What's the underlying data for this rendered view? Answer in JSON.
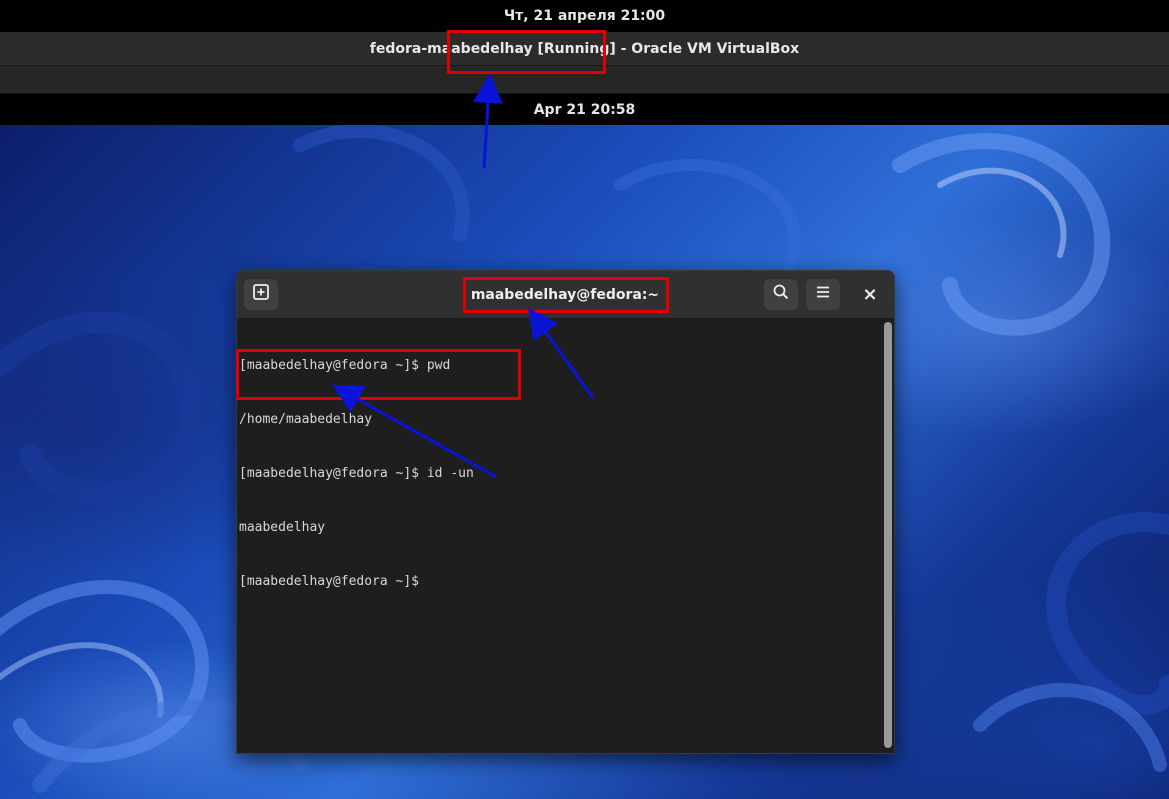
{
  "host": {
    "datetime": "Чт, 21 апреля  21:00"
  },
  "vbox": {
    "window_title": "fedora-maabedelhay [Running] - Oracle VM VirtualBox"
  },
  "guest": {
    "datetime": "Apr 21  20:58"
  },
  "terminal": {
    "title": "maabedelhay@fedora:~",
    "buttons": {
      "new_tab_icon": "tab-new-icon",
      "search_icon": "search-icon",
      "menu_icon": "hamburger-menu-icon",
      "close_icon": "close-icon",
      "close_glyph": "×"
    },
    "lines": [
      "[maabedelhay@fedora ~]$ pwd",
      "/home/maabedelhay",
      "[maabedelhay@fedora ~]$ id -un",
      "maabedelhay",
      "[maabedelhay@fedora ~]$ "
    ]
  },
  "colors": {
    "annotation_box": "#e00000",
    "annotation_arrow": "#0a14d8",
    "terminal_bg": "#1e1e1e",
    "header_bg": "#303030"
  }
}
